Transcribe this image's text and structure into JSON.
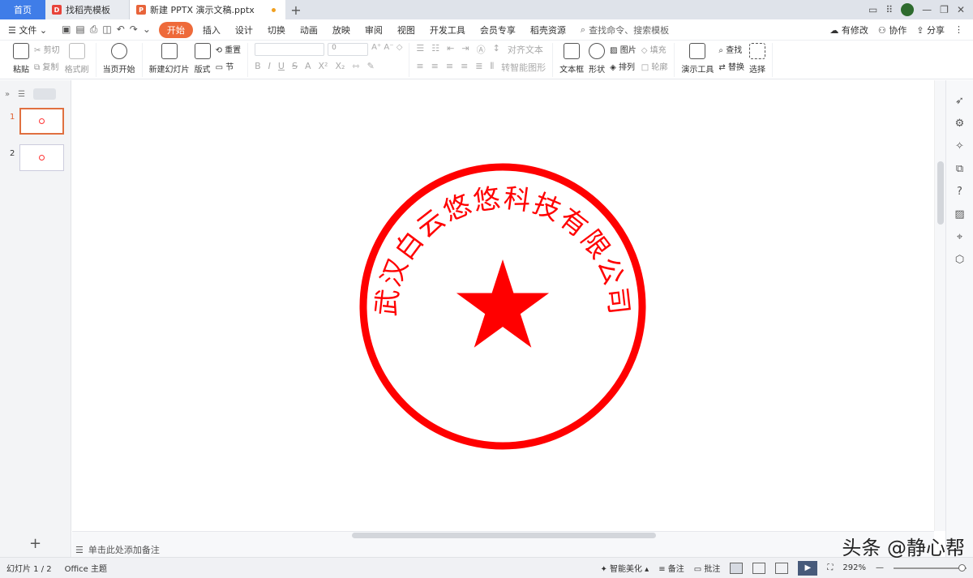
{
  "tabs": {
    "home": "首页",
    "template": "找稻壳模板",
    "document": "新建 PPTX 演示文稿.pptx"
  },
  "menu": {
    "file": "文件",
    "items": [
      "开始",
      "插入",
      "设计",
      "切换",
      "动画",
      "放映",
      "审阅",
      "视图",
      "开发工具",
      "会员专享",
      "稻壳资源"
    ],
    "search": "查找命令、搜索模板",
    "right": [
      "有修改",
      "协作",
      "分享"
    ]
  },
  "ribbon": {
    "paste": "粘贴",
    "cut": "剪切",
    "copy": "复制",
    "format_painter": "格式刷",
    "play_from_current": "当页开始",
    "new_slide": "新建幻灯片",
    "layout": "版式",
    "reset": "重置",
    "section": "节",
    "font_size": "0",
    "align_text": "对齐文本",
    "smart_graphic": "转智能图形",
    "textbox": "文本框",
    "shape": "形状",
    "picture": "图片",
    "arrange": "排列",
    "fill": "填充",
    "outline": "轮廓",
    "present_tools": "演示工具",
    "find": "查找",
    "replace": "替换",
    "select": "选择"
  },
  "left_panel": {
    "slides": [
      "1",
      "2"
    ]
  },
  "seal": {
    "text": "武汉白云悠悠科技有限公司",
    "color": "#ff0000"
  },
  "notes": {
    "placeholder": "单击此处添加备注"
  },
  "status": {
    "slide_count": "幻灯片 1 / 2",
    "theme": "Office 主题",
    "smart_beautify": "智能美化",
    "notes": "备注",
    "comments": "批注",
    "zoom": "292%"
  },
  "watermark": "头条 @静心帮"
}
